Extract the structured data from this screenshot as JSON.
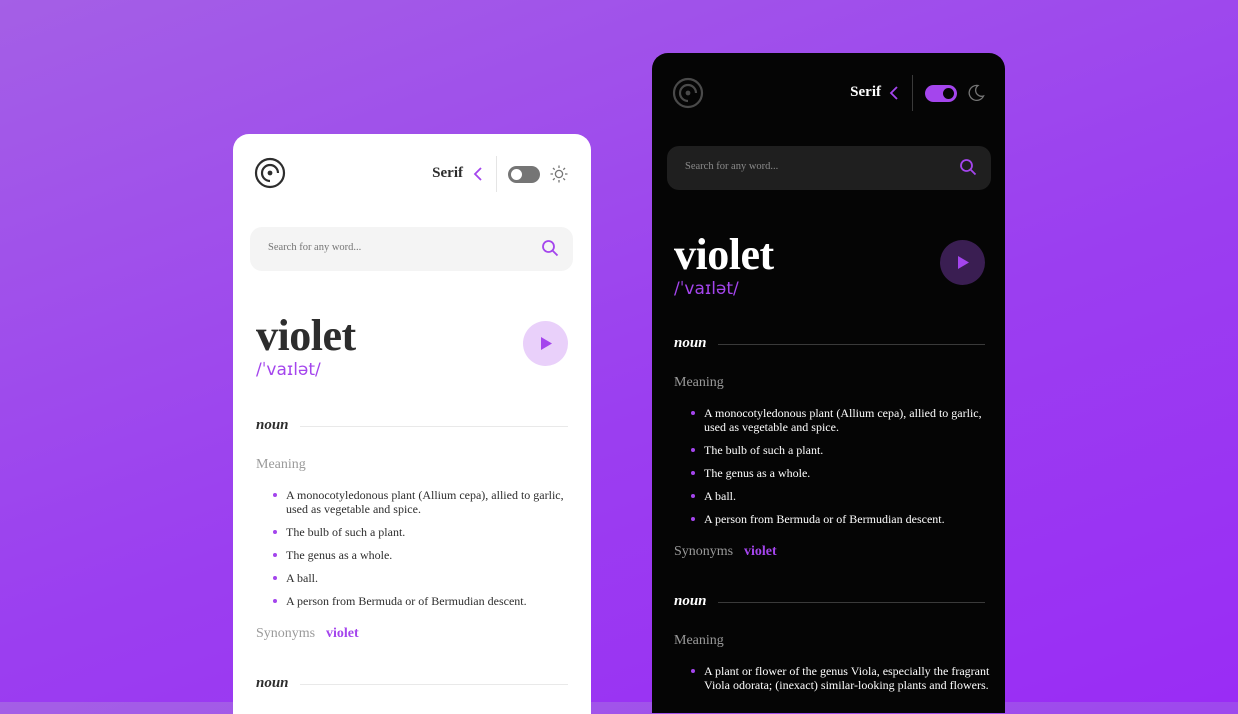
{
  "colors": {
    "accent": "#a445ed",
    "light_bg": "#ffffff",
    "dark_bg": "#050505"
  },
  "light": {
    "theme_icon": "sun-icon",
    "font_select": "Serif",
    "search_placeholder": "Search for any word...",
    "word": "violet",
    "phonetic": "/ˈvaɪlət/",
    "section1": {
      "pos": "noun",
      "meaning_label": "Meaning",
      "definitions": [
        "A monocotyledonous plant (Allium cepa), allied to garlic, used as vegetable and spice.",
        "The bulb of such a plant.",
        "The genus as a whole.",
        "A ball.",
        "A person from Bermuda or of Bermudian descent."
      ],
      "synonyms_label": "Synonyms",
      "synonym": "violet"
    },
    "section2": {
      "pos": "noun"
    }
  },
  "dark": {
    "theme_icon": "moon-icon",
    "font_select": "Serif",
    "search_placeholder": "Search for any word...",
    "word": "violet",
    "phonetic": "/ˈvaɪlət/",
    "section1": {
      "pos": "noun",
      "meaning_label": "Meaning",
      "definitions": [
        "A monocotyledonous plant (Allium cepa), allied to garlic, used as vegetable and spice.",
        "The bulb of such a plant.",
        "The genus as a whole.",
        "A ball.",
        "A person from Bermuda or of Bermudian descent."
      ],
      "synonyms_label": "Synonyms",
      "synonym": "violet"
    },
    "section2": {
      "pos": "noun",
      "meaning_label": "Meaning",
      "definitions": [
        "A plant or flower of the genus Viola, especially the fragrant Viola odorata; (inexact) similar-looking plants and flowers."
      ]
    }
  }
}
